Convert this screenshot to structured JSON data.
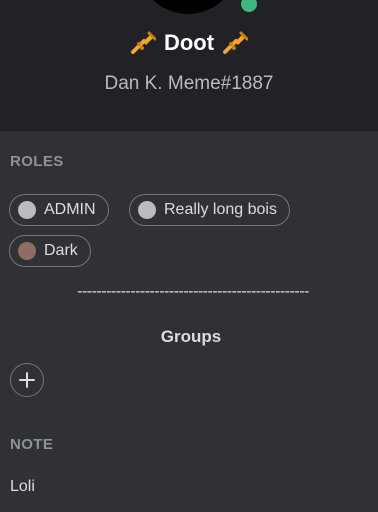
{
  "profile": {
    "display_name": "Doot",
    "username": "Dan K. Meme",
    "discriminator": "#1887",
    "status_color": "#43b581",
    "name_icon": "trumpet-icon"
  },
  "roles": {
    "title": "ROLES",
    "items": [
      {
        "label": "ADMIN",
        "color": "#b9bbbe"
      },
      {
        "label": "Really long bois",
        "color": "#b9bbbe"
      },
      {
        "label": "Dark",
        "color": "#8d6e63"
      }
    ]
  },
  "groups": {
    "separator": "------------------------------------------------",
    "title": "Groups",
    "add_icon": "plus-icon"
  },
  "note": {
    "title": "NOTE",
    "value": "Loli"
  }
}
